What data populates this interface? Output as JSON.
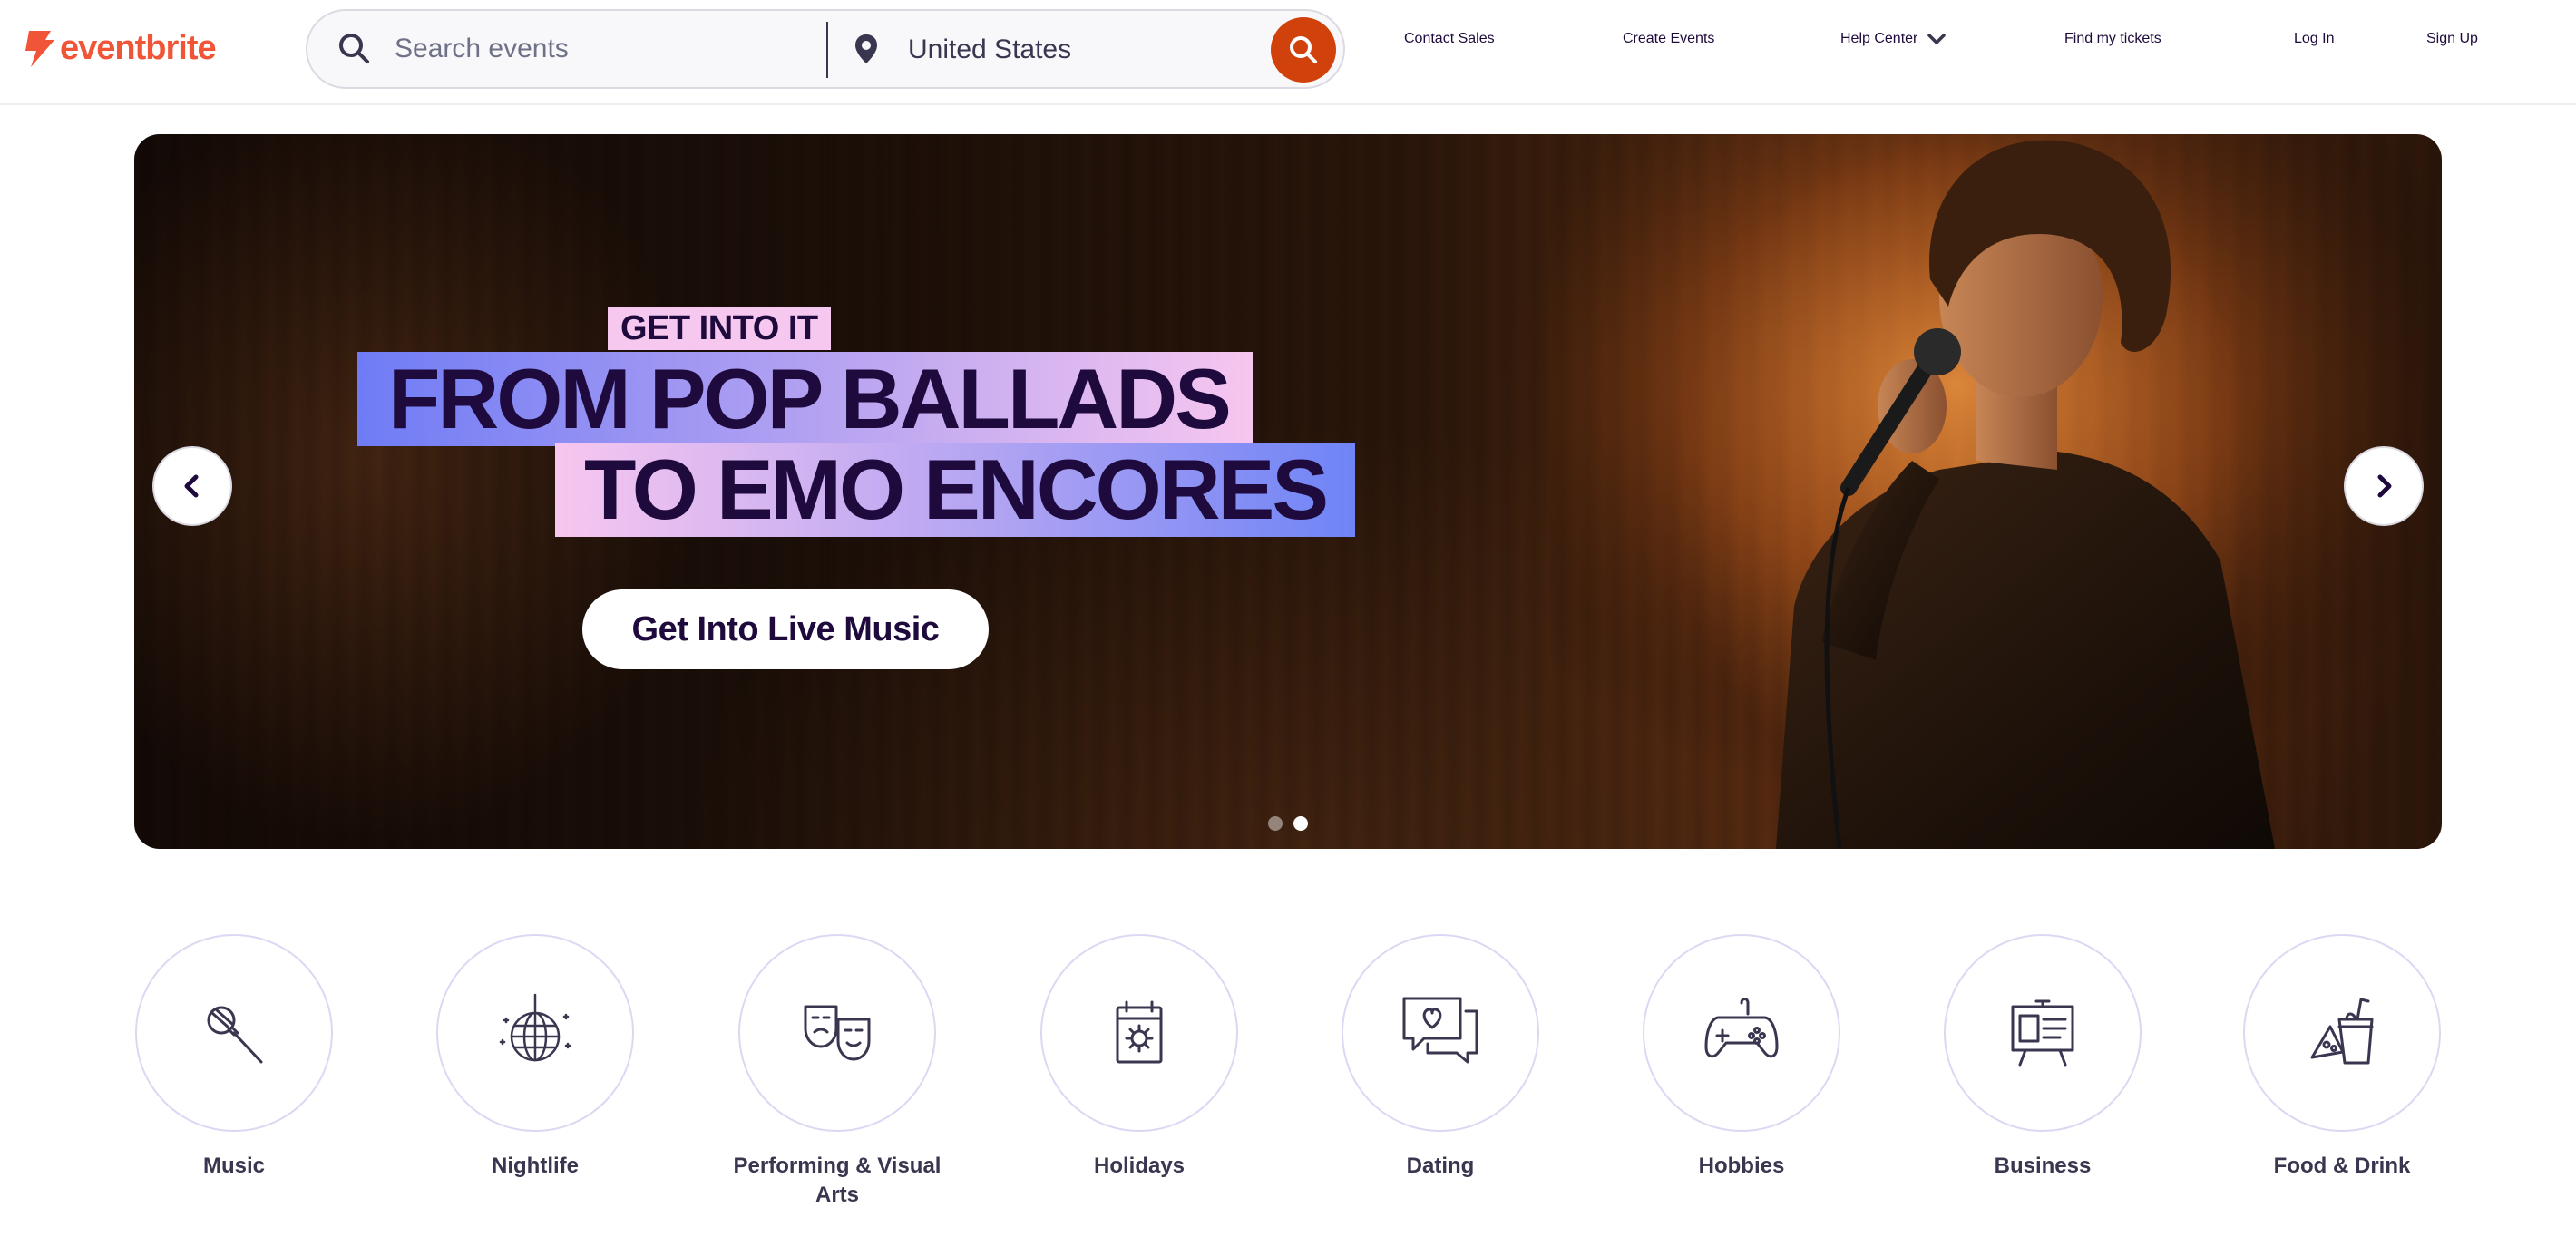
{
  "header": {
    "brand": "eventbrite",
    "search": {
      "placeholder": "Search events",
      "location": "United States"
    },
    "nav": {
      "contact_sales": "Contact Sales",
      "create_events": "Create Events",
      "help_center": "Help Center",
      "find_tickets": "Find my tickets",
      "log_in": "Log In",
      "sign_up": "Sign Up"
    }
  },
  "hero": {
    "kicker": "GET INTO IT",
    "headline_line1": "FROM POP BALLADS",
    "headline_line2": "TO EMO ENCORES",
    "cta": "Get Into Live Music",
    "slide_count": 2,
    "active_slide": 2
  },
  "categories": [
    {
      "label": "Music",
      "icon": "microphone-icon"
    },
    {
      "label": "Nightlife",
      "icon": "disco-ball-icon"
    },
    {
      "label": "Performing & Visual Arts",
      "icon": "theater-masks-icon"
    },
    {
      "label": "Holidays",
      "icon": "calendar-sun-icon"
    },
    {
      "label": "Dating",
      "icon": "chat-heart-icon"
    },
    {
      "label": "Hobbies",
      "icon": "game-controller-icon"
    },
    {
      "label": "Business",
      "icon": "presentation-board-icon"
    },
    {
      "label": "Food & Drink",
      "icon": "food-drink-icon"
    }
  ],
  "colors": {
    "brand": "#f05537",
    "search_button": "#d1410c",
    "text_dark": "#1e0a3c",
    "text_nav": "#39364f",
    "category_ring": "#dcd8f3"
  }
}
